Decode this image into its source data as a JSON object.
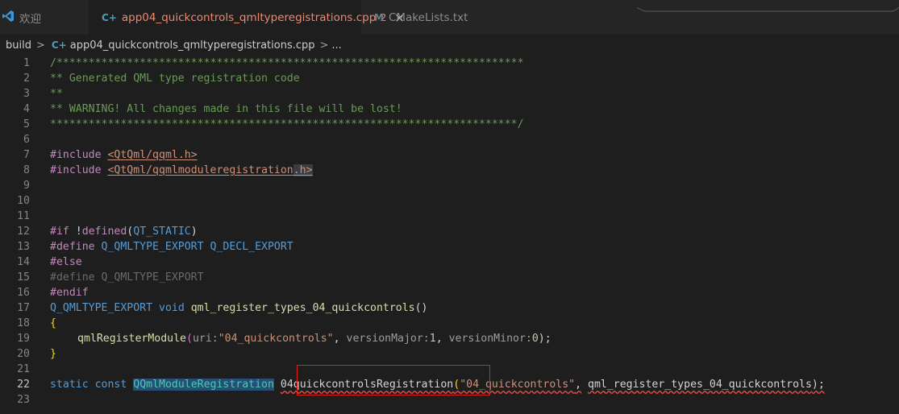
{
  "tabs": [
    {
      "label": "欢迎",
      "icon": "vscode-icon"
    },
    {
      "label": "app04_quickcontrols_qmltyperegistrations.cpp",
      "badge": "2",
      "icon": "cpp-file-icon",
      "close": "×"
    },
    {
      "label": "CMakeLists.txt",
      "icon": "cmake-icon"
    }
  ],
  "breadcrumb": {
    "folder": "build",
    "sep1": ">",
    "file": "app04_quickcontrols_qmltyperegistrations.cpp",
    "sep2": ">",
    "more": "..."
  },
  "code": {
    "l1": "/*************************************************************************",
    "l2": "** Generated QML type registration code",
    "l3": "**",
    "l4": "** WARNING! All changes made in this file will be lost!",
    "l5": "*************************************************************************/",
    "l7_kw": "#include",
    "l7_path": "<QtQml/qqml.h>",
    "l8_kw": "#include",
    "l8_path_a": "<QtQml/qqmlmoduleregistration",
    "l8_path_b": ".h>",
    "l12_kw": "#if",
    "l12_bang": " !",
    "l12_defined": "defined",
    "l12_open": "(",
    "l12_macro": "QT_STATIC",
    "l12_close": ")",
    "l13_kw": "#define",
    "l13_a": "Q_QMLTYPE_EXPORT",
    "l13_b": "Q_DECL_EXPORT",
    "l14_kw": "#else",
    "l15": "#define Q_QMLTYPE_EXPORT",
    "l16_kw": "#endif",
    "l17_macro": "Q_QMLTYPE_EXPORT",
    "l17_kw": "void",
    "l17_fn": "qml_register_types_04_quickcontrols",
    "l17_paren": "()",
    "l18": "{",
    "l19_fn": "qmlRegisterModule",
    "l19_open": "(",
    "l19_hint1": "uri:",
    "l19_str": "\"04_quickcontrols\"",
    "l19_comma1": ",",
    "l19_hint2": "versionMajor:",
    "l19_num1": "1",
    "l19_comma2": ",",
    "l19_hint3": "versionMinor:",
    "l19_num2": "0",
    "l19_close": ");",
    "l20": "}",
    "l22_kw1": "static",
    "l22_kw2": "const",
    "l22_type": "QQmlModuleRegistration",
    "l22_var": "04quickcontrolsRegistration",
    "l22_open": "(",
    "l22_str": "\"04_quickcontrols\"",
    "l22_comma": ",",
    "l22_arg": "qml_register_types_04_quickcontrols",
    "l22_close": ");"
  },
  "line_numbers": [
    "1",
    "2",
    "3",
    "4",
    "5",
    "6",
    "7",
    "8",
    "9",
    "10",
    "11",
    "12",
    "13",
    "14",
    "15",
    "16",
    "17",
    "18",
    "19",
    "20",
    "21",
    "22",
    "23"
  ],
  "colors": {
    "background": "#1e1e1e",
    "tabbar": "#252526",
    "active_tab_text": "#ec8a6e",
    "comment": "#6a9955",
    "keyword": "#569cd6",
    "preprocessor": "#c586c0",
    "string": "#ce9178",
    "highlight_box": "#e0201a"
  }
}
